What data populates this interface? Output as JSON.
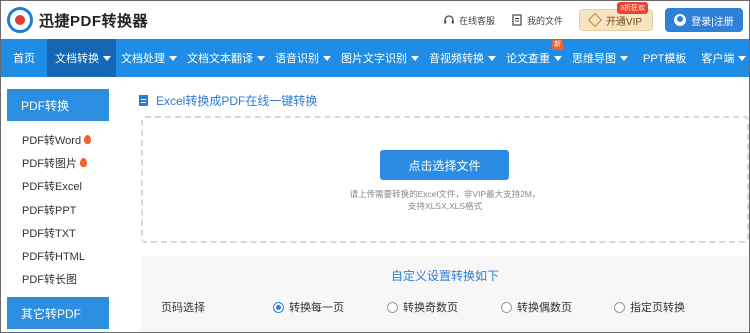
{
  "header": {
    "brand": "迅捷PDF转换器",
    "service_label": "在线客服",
    "files_label": "我的文件",
    "vip_label": "开通VIP",
    "vip_badge": "3折狂欢",
    "login_label": "登录|注册"
  },
  "nav": {
    "items": [
      {
        "label": "首页",
        "dropdown": false
      },
      {
        "label": "文档转换",
        "dropdown": true,
        "active": true
      },
      {
        "label": "文档处理",
        "dropdown": true
      },
      {
        "label": "文档文本翻译",
        "dropdown": true
      },
      {
        "label": "语音识别",
        "dropdown": true
      },
      {
        "label": "图片文字识别",
        "dropdown": true
      },
      {
        "label": "音视频转换",
        "dropdown": true
      },
      {
        "label": "论文查重",
        "dropdown": true,
        "badge": "新"
      },
      {
        "label": "思维导图",
        "dropdown": true
      },
      {
        "label": "PPT模板",
        "dropdown": false
      },
      {
        "label": "客户端",
        "dropdown": true
      }
    ]
  },
  "sidebar": {
    "heading": "PDF转换",
    "items": [
      {
        "label": "PDF转Word",
        "hot": true
      },
      {
        "label": "PDF转图片",
        "hot": true
      },
      {
        "label": "PDF转Excel",
        "hot": false
      },
      {
        "label": "PDF转PPT",
        "hot": false
      },
      {
        "label": "PDF转TXT",
        "hot": false
      },
      {
        "label": "PDF转HTML",
        "hot": false
      },
      {
        "label": "PDF转长图",
        "hot": false
      }
    ],
    "heading2": "其它转PDF"
  },
  "main": {
    "title": "Excel转换成PDF在线一键转换",
    "upload_button": "点击选择文件",
    "hint_line1": "请上传需要转换的Excel文件，非VIP最大支持2M，",
    "hint_line2": "支持XLSX,XLS格式"
  },
  "settings": {
    "title": "自定义设置转换如下",
    "row_label": "页码选择",
    "options": [
      {
        "label": "转换每一页",
        "checked": true
      },
      {
        "label": "转换奇数页",
        "checked": false
      },
      {
        "label": "转换偶数页",
        "checked": false
      },
      {
        "label": "指定页转换",
        "checked": false
      }
    ]
  },
  "colors": {
    "nav_bg": "#1f8de6",
    "nav_active": "#1566b4",
    "accent": "#2c82d8"
  }
}
